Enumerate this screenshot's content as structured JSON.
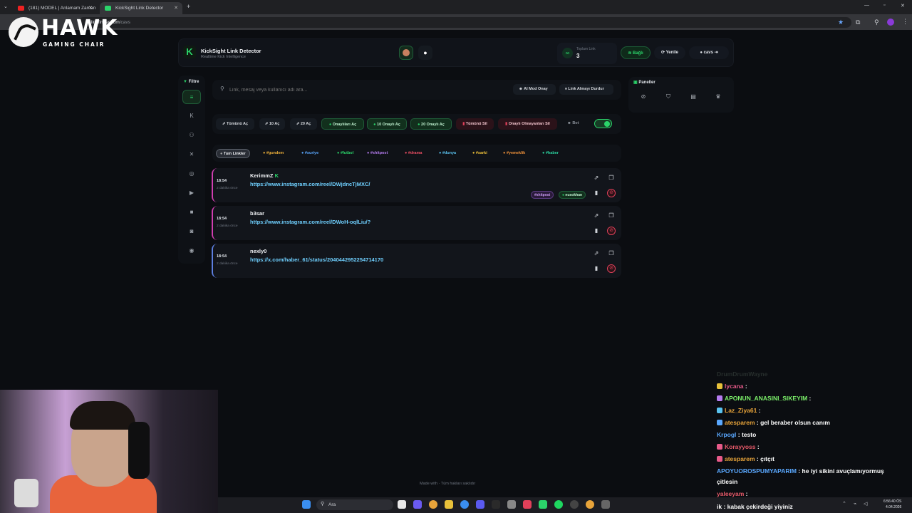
{
  "browser": {
    "tabs": [
      {
        "label": "(181) MODEL | Anlamam Zaman",
        "active": false
      },
      {
        "label": "KickSight Link Detector",
        "active": true
      }
    ],
    "url_host": "linkfinder.com",
    "url_path": "/cavs"
  },
  "overlay": {
    "brand": "HAWK",
    "sub": "GAMING CHAIR"
  },
  "header": {
    "title": "KickSight Link Detector",
    "subtitle": "Realtime Kick Intelligence",
    "stat_label": "Toplam Link",
    "stat_value": "3",
    "connected_label": "Bağlı",
    "refresh_label": "Yenile",
    "user_label": "cavs"
  },
  "sidebar": {
    "title": "Filtre",
    "items": [
      "list-icon",
      "kick-icon",
      "users-icon",
      "x-icon",
      "instagram-icon",
      "youtube-icon",
      "video-icon",
      "camera-icon",
      "globe-icon"
    ]
  },
  "search": {
    "placeholder": "Link, mesaj veya kullanıcı adı ara...",
    "ai_mod_label": "AI Mod Onay",
    "stop_label": "Link Almayı Durdur"
  },
  "actions": {
    "open_all": "Tümünü Aç",
    "open_10": "10 Aç",
    "open_20": "20 Aç",
    "open_approved": "Onaylıları Aç",
    "open_10_approved": "10 Onaylı Aç",
    "open_20_approved": "20 Onaylı Aç",
    "delete_all": "Tümünü Sil",
    "delete_unapproved": "Onaylı Olmayanları Sil",
    "bot_label": "Bot"
  },
  "categories": [
    {
      "label": "Tum Linkler",
      "color": "#f0f2f5"
    },
    {
      "label": "#gundem",
      "color": "#f0b23a"
    },
    {
      "label": "#suriye",
      "color": "#5aa8ff"
    },
    {
      "label": "#futbol",
      "color": "#2bd46a"
    },
    {
      "label": "#shitpost",
      "color": "#b57cf0"
    },
    {
      "label": "#drama",
      "color": "#ef4f64"
    },
    {
      "label": "#dunya",
      "color": "#5ac3f0"
    },
    {
      "label": "#sarki",
      "color": "#f0c23a"
    },
    {
      "label": "#yemeklik",
      "color": "#f0923a"
    },
    {
      "label": "#haber",
      "color": "#2bd4a0"
    }
  ],
  "rows": [
    {
      "time": "18:54",
      "ago": "2 dakika önce",
      "user": "KerimmZ",
      "link": "https://www.instagram.com/reel/DWjdncTjMXC/",
      "tags": [
        "#shitpost",
        "nusokhan"
      ]
    },
    {
      "time": "18:54",
      "ago": "2 dakika önce",
      "user": "b3sar",
      "link": "https://www.instagram.com/reel/DWoH-oqlLiu/?",
      "tags": []
    },
    {
      "time": "18:54",
      "ago": "2 dakika önce",
      "user": "nexly0",
      "link": "https://x.com/haber_61/status/2040442952254714170",
      "tags": []
    }
  ],
  "panels": {
    "title": "Paneller"
  },
  "footer": {
    "text": "Made with  · Tüm hakları saklıdır"
  },
  "chat": [
    {
      "name": "DrumDrumWayne",
      "text": "",
      "color": "#5a6a5e"
    },
    {
      "name": "lycana",
      "text": "",
      "color": "#e85a8a"
    },
    {
      "name": "APONUN_ANASINI_SIKEYIM",
      "text": "",
      "color": "#7cf06a"
    },
    {
      "name": "Laz_Ziya61",
      "text": "",
      "color": "#e8a43a"
    },
    {
      "name": "atesparem",
      "text": "gel beraber olsun canım",
      "color": "#e8a43a"
    },
    {
      "name": "Krpogl",
      "text": "testo",
      "color": "#5aa8ff"
    },
    {
      "name": "Korayyoss",
      "text": "",
      "color": "#e85a6a"
    },
    {
      "name": "atesparem",
      "text": "çıtçıt",
      "color": "#e8a43a"
    },
    {
      "name": "APOYUOROSPUMYAPARIM",
      "text": "he iyi sikini avuçlamıyormuş",
      "color": "#5aa8ff"
    },
    {
      "name": "",
      "text": "çitlesin",
      "color": "#fff"
    },
    {
      "name": "yaleeyam",
      "text": "",
      "color": "#e85a6a"
    }
  ],
  "bottom_chat": "ik : kabak çekirdeği yiyiniz",
  "taskbar": {
    "search_label": "Ara",
    "time": "6:56:40 ÖS",
    "date": "4.04.2026"
  }
}
